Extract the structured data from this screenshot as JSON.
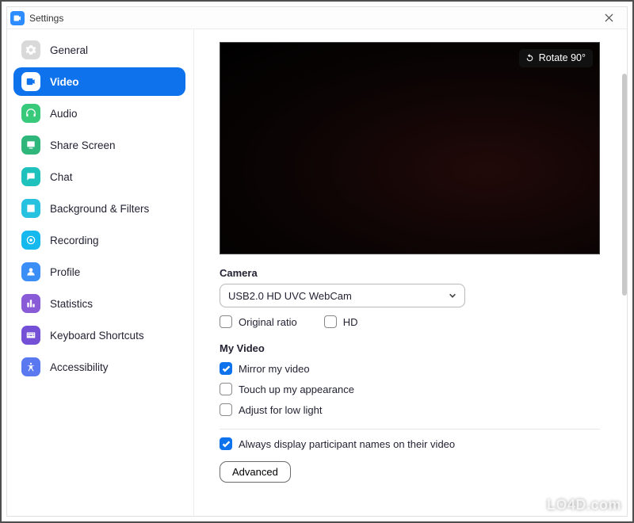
{
  "window": {
    "title": "Settings"
  },
  "sidebar": {
    "items": [
      {
        "label": "General",
        "icon": "gear-icon",
        "color": "#d9d9d9"
      },
      {
        "label": "Video",
        "icon": "video-icon",
        "color": "#ffffff",
        "active": true
      },
      {
        "label": "Audio",
        "icon": "headphones-icon",
        "color": "#38c97a"
      },
      {
        "label": "Share Screen",
        "icon": "share-screen-icon",
        "color": "#2fb67b"
      },
      {
        "label": "Chat",
        "icon": "chat-icon",
        "color": "#1fc1bd"
      },
      {
        "label": "Background & Filters",
        "icon": "background-icon",
        "color": "#26c2e0"
      },
      {
        "label": "Recording",
        "icon": "recording-icon",
        "color": "#16b9ee"
      },
      {
        "label": "Profile",
        "icon": "profile-icon",
        "color": "#3a8ef6"
      },
      {
        "label": "Statistics",
        "icon": "statistics-icon",
        "color": "#8a5bd7"
      },
      {
        "label": "Keyboard Shortcuts",
        "icon": "keyboard-icon",
        "color": "#7350d5"
      },
      {
        "label": "Accessibility",
        "icon": "accessibility-icon",
        "color": "#5a78f0"
      }
    ]
  },
  "content": {
    "rotate_label": "Rotate 90°",
    "camera_label": "Camera",
    "camera_selected": "USB2.0 HD UVC WebCam",
    "original_ratio_label": "Original ratio",
    "hd_label": "HD",
    "my_video_label": "My Video",
    "mirror_label": "Mirror my video",
    "touch_up_label": "Touch up my appearance",
    "low_light_label": "Adjust for low light",
    "participant_names_label": "Always display participant names on their video",
    "advanced_label": "Advanced"
  },
  "watermark": "LO4D.com"
}
